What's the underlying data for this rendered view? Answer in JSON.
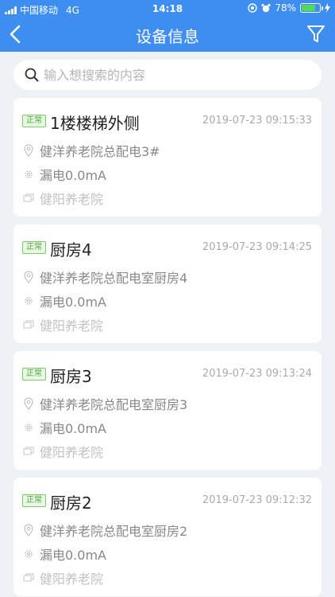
{
  "status_bar": {
    "carrier": "中国移动",
    "network": "4G",
    "time": "14:18",
    "battery": "78%",
    "battery_level": 0.78
  },
  "navbar": {
    "title": "设备信息",
    "back_icon": "chevron-left-icon",
    "filter_icon": "filter-icon"
  },
  "search": {
    "placeholder": "输入想搜索的内容"
  },
  "devices": [
    {
      "status": "正常",
      "name": "1楼楼梯外侧",
      "time": "2019-07-23 09:15:33",
      "location": "健洋养老院总配电3#",
      "leakage": "漏电0.0mA",
      "org": "健阳养老院"
    },
    {
      "status": "正常",
      "name": "厨房4",
      "time": "2019-07-23 09:14:25",
      "location": "健洋养老院总配电室厨房4",
      "leakage": "漏电0.0mA",
      "org": "健阳养老院"
    },
    {
      "status": "正常",
      "name": "厨房3",
      "time": "2019-07-23 09:13:24",
      "location": "健洋养老院总配电室厨房3",
      "leakage": "漏电0.0mA",
      "org": "健阳养老院"
    },
    {
      "status": "正常",
      "name": "厨房2",
      "time": "2019-07-23 09:12:32",
      "location": "健洋养老院总配电室厨房2",
      "leakage": "漏电0.0mA",
      "org": "健阳养老院"
    }
  ],
  "colors": {
    "header": "#3d8ef0",
    "status_badge": "#4aa63a",
    "background": "#eef1f6"
  }
}
